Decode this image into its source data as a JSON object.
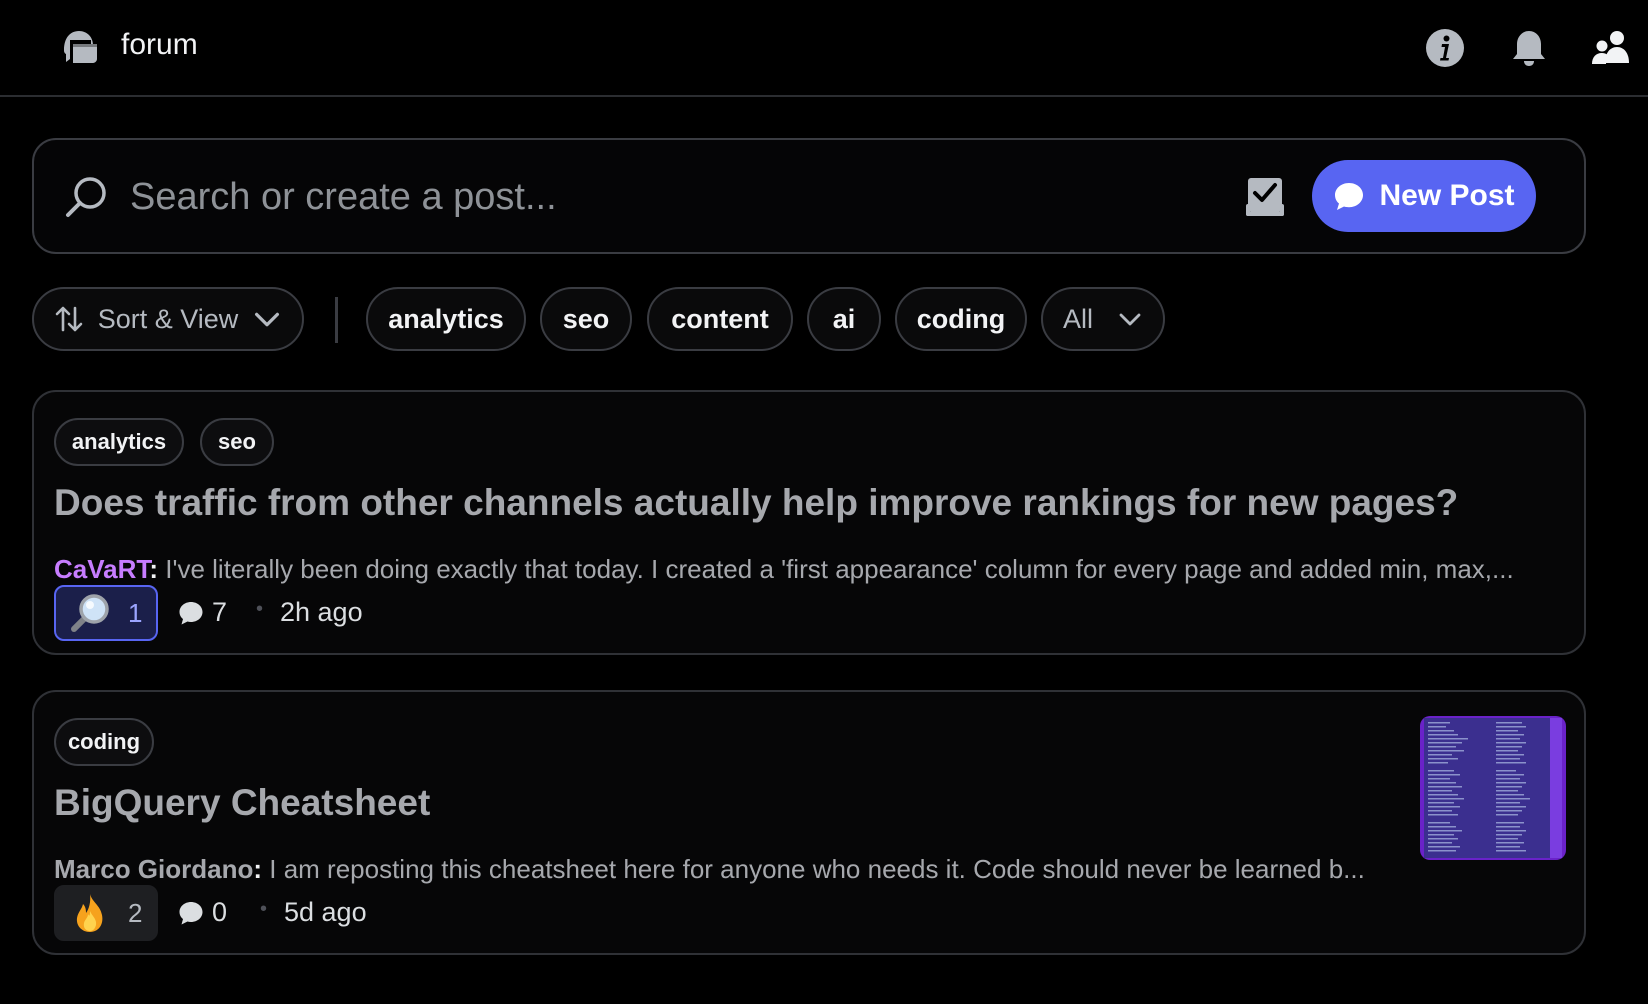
{
  "header": {
    "title": "forum",
    "icons": [
      "forum-icon",
      "info-icon",
      "bell-icon",
      "members-icon"
    ]
  },
  "search": {
    "placeholder": "Search or create a post...",
    "value": "",
    "new_post_label": "New Post",
    "icons": [
      "search-icon",
      "checklist-icon",
      "chat-bubble-icon"
    ]
  },
  "filters": {
    "sort_label": "Sort & View",
    "tags": [
      "analytics",
      "seo",
      "content",
      "ai",
      "coding"
    ],
    "all_label": "All"
  },
  "posts": [
    {
      "tags": [
        "analytics",
        "seo"
      ],
      "title": "Does traffic from other channels actually help improve rankings for new pages?",
      "author": "CaVaRT",
      "author_color": "#c77dff",
      "separator": ":",
      "snippet": " I've literally been doing exactly that today. I created a 'first appearance' column for every page and added min, max,...",
      "reaction_icon": "magnifying-glass-emoji",
      "reaction_count": "1",
      "reaction_active": true,
      "comments": "7",
      "time": "2h ago"
    },
    {
      "tags": [
        "coding"
      ],
      "title": "BigQuery Cheatsheet",
      "author": "Marco Giordano",
      "author_color": "#a6a8ad",
      "separator": ":",
      "snippet": " I am reposting this cheatsheet here for anyone who needs it. Code should never be learned b...",
      "reaction_icon": "fire-emoji",
      "reaction_count": "2",
      "reaction_active": false,
      "comments": "0",
      "time": "5d ago",
      "thumbnail": "cheatsheet-image"
    }
  ],
  "colors": {
    "accent": "#5865f2",
    "background": "#000000",
    "card_border": "#2f3136"
  }
}
